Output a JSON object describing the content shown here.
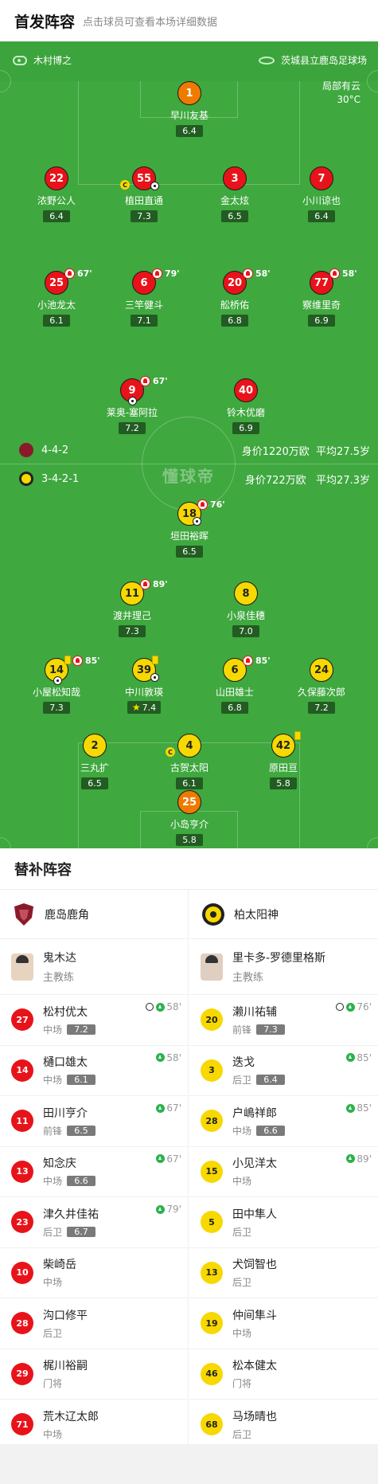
{
  "header": {
    "title": "首发阵容",
    "subtitle": "点击球员可查看本场详细数据"
  },
  "match_info": {
    "referee": "木村博之",
    "stadium": "茨城县立鹿岛足球场",
    "weather": "局部有云",
    "temperature": "30°C"
  },
  "home_team": {
    "formation": "4-4-2",
    "value": "身价1220万欧",
    "avg_age": "平均27.5岁"
  },
  "away_team": {
    "formation": "3-4-2-1",
    "value": "身价722万欧",
    "avg_age": "平均27.3岁"
  },
  "watermark": "懂球帝",
  "home_players": [
    {
      "number": "1",
      "name": "早川友基",
      "rating": "6.4"
    },
    {
      "number": "22",
      "name": "浓野公人",
      "rating": "6.4"
    },
    {
      "number": "55",
      "name": "植田直通",
      "rating": "7.3"
    },
    {
      "number": "3",
      "name": "金太炫",
      "rating": "6.5"
    },
    {
      "number": "7",
      "name": "小川谅也",
      "rating": "6.4"
    },
    {
      "number": "25",
      "name": "小池龙太",
      "rating": "6.1",
      "sub_time": "67'"
    },
    {
      "number": "6",
      "name": "三竿健斗",
      "rating": "7.1",
      "sub_time": "79'"
    },
    {
      "number": "20",
      "name": "舩桥佑",
      "rating": "6.8",
      "sub_time": "58'"
    },
    {
      "number": "77",
      "name": "察维里奇",
      "rating": "6.9",
      "sub_time": "58'"
    },
    {
      "number": "9",
      "name": "莱奥-塞阿拉",
      "rating": "7.2",
      "sub_time": "67'"
    },
    {
      "number": "40",
      "name": "铃木优磨",
      "rating": "6.9"
    }
  ],
  "away_players": [
    {
      "number": "18",
      "name": "垣田裕晖",
      "rating": "6.5",
      "sub_time": "76'"
    },
    {
      "number": "11",
      "name": "渡井理己",
      "rating": "7.3",
      "sub_time": "89'"
    },
    {
      "number": "8",
      "name": "小泉佳穗",
      "rating": "7.0"
    },
    {
      "number": "14",
      "name": "小屋松知哉",
      "rating": "7.3",
      "sub_time": "85'"
    },
    {
      "number": "39",
      "name": "中川敦瑛",
      "rating": "7.4"
    },
    {
      "number": "6",
      "name": "山田雄士",
      "rating": "6.8",
      "sub_time": "85'"
    },
    {
      "number": "24",
      "name": "久保藤次郎",
      "rating": "7.2"
    },
    {
      "number": "2",
      "name": "三丸扩",
      "rating": "6.5"
    },
    {
      "number": "4",
      "name": "古贺太阳",
      "rating": "6.1"
    },
    {
      "number": "42",
      "name": "原田亘",
      "rating": "5.8"
    },
    {
      "number": "25",
      "name": "小岛亨介",
      "rating": "5.8"
    }
  ],
  "subs_title": "替补阵容",
  "home_bench": {
    "team": "鹿岛鹿角",
    "coach": {
      "name": "鬼木达",
      "role": "主教练"
    },
    "players": [
      {
        "number": "27",
        "name": "松村优太",
        "pos": "中场",
        "rating": "7.2",
        "time": "58'"
      },
      {
        "number": "14",
        "name": "樋口雄太",
        "pos": "中场",
        "rating": "6.1",
        "time": "58'"
      },
      {
        "number": "11",
        "name": "田川亨介",
        "pos": "前锋",
        "rating": "6.5",
        "time": "67'"
      },
      {
        "number": "13",
        "name": "知念庆",
        "pos": "中场",
        "rating": "6.6",
        "time": "67'"
      },
      {
        "number": "23",
        "name": "津久井佳祐",
        "pos": "后卫",
        "rating": "6.7",
        "time": "79'"
      },
      {
        "number": "10",
        "name": "柴崎岳",
        "pos": "中场"
      },
      {
        "number": "28",
        "name": "沟口修平",
        "pos": "后卫"
      },
      {
        "number": "29",
        "name": "梶川裕嗣",
        "pos": "门将"
      },
      {
        "number": "71",
        "name": "荒木辽太郎",
        "pos": "中场"
      }
    ]
  },
  "away_bench": {
    "team": "柏太阳神",
    "coach": {
      "name": "里卡多-罗德里格斯",
      "role": "主教练"
    },
    "players": [
      {
        "number": "20",
        "name": "濑川祐辅",
        "pos": "前锋",
        "rating": "7.3",
        "time": "76'"
      },
      {
        "number": "3",
        "name": "迭戈",
        "pos": "后卫",
        "rating": "6.4",
        "time": "85'"
      },
      {
        "number": "28",
        "name": "户嶋祥郎",
        "pos": "中场",
        "rating": "6.6",
        "time": "85'"
      },
      {
        "number": "15",
        "name": "小见洋太",
        "pos": "中场",
        "time": "89'"
      },
      {
        "number": "5",
        "name": "田中隼人",
        "pos": "后卫"
      },
      {
        "number": "13",
        "name": "犬饲智也",
        "pos": "后卫"
      },
      {
        "number": "19",
        "name": "仲间隼斗",
        "pos": "中场"
      },
      {
        "number": "46",
        "name": "松本健太",
        "pos": "门将"
      },
      {
        "number": "68",
        "name": "马场晴也",
        "pos": "后卫"
      }
    ]
  }
}
